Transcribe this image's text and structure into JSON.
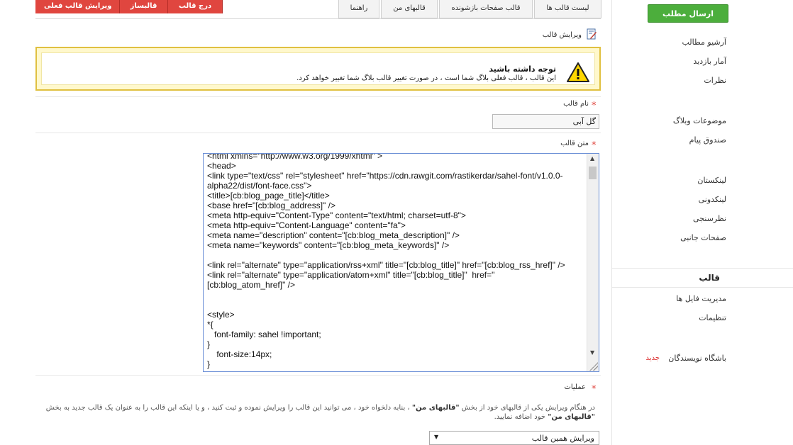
{
  "sidebar": {
    "send_button": "ارسال مطلب",
    "group1": [
      "آرشیو مطالب",
      "آمار بازدید",
      "نظرات"
    ],
    "group2": [
      "موضوعات وبلاگ",
      "صندوق پیام"
    ],
    "group3": [
      "لینکستان",
      "لینکدونی",
      "نظرسنجی",
      "صفحات جانبی"
    ],
    "section_title": "قالب",
    "group4": [
      "مدیریت فایل ها",
      "تنظیمات"
    ],
    "writers_club": "باشگاه نویسندگان",
    "new_badge": "جدید"
  },
  "top_buttons": [
    "ویرایش قالب فعلی",
    "قالبساز",
    "درج قالب"
  ],
  "tabs": [
    "لیست قالب ها",
    "قالب صفحات بازشونده",
    "قالبهای من",
    "راهنما"
  ],
  "page_heading": "ویرایش قالب",
  "warning": {
    "title": "توجه داشته باشید",
    "text": "این قالب ، قالب فعلی بلاگ شما است ، در صورت تغییر قالب بلاگ شما تغییر خواهد کرد."
  },
  "form": {
    "name_label": "نام قالب",
    "name_value": "گل آبی",
    "body_label": "متن قالب",
    "code_lines": [
      "<html xmlns=\"http://www.w3.org/1999/xhtml\" >",
      "<head>",
      "<link type=\"text/css\" rel=\"stylesheet\" href=\"https://cdn.rawgit.com/rastikerdar/sahel-font/v1.0.0-",
      "alpha22/dist/font-face.css\">",
      "<title>[cb:blog_page_title]</title>",
      "<base href=\"[cb:blog_address]\" />",
      "<meta http-equiv=\"Content-Type\" content=\"text/html; charset=utf-8\">",
      "<meta http-equiv=\"Content-Language\" content=\"fa\">",
      "<meta name=\"description\" content=\"[cb:blog_meta_description]\" />",
      "<meta name=\"keywords\" content=\"[cb:blog_meta_keywords]\" />",
      "",
      "<link rel=\"alternate\" type=\"application/rss+xml\" title=\"[cb:blog_title]\" href=\"[cb:blog_rss_href]\" />",
      "<link rel=\"alternate\" type=\"application/atom+xml\" title=\"[cb:blog_title]\"  href=\"",
      "[cb:blog_atom_href]\" />",
      "",
      "",
      "<style>",
      "*{",
      "   font-family: sahel !important;",
      "}",
      "    font-size:14px;",
      "}"
    ],
    "ops_label": "عملیات",
    "ops_desc_1": "در هنگام ویرایش یکی از قالبهای خود از بخش ",
    "ops_desc_bold_1": "\"قالبهای من\"",
    "ops_desc_2": " ، بنابه دلخواه خود ، می توانید این قالب را ویرایش نموده و ثبت کنید ، و یا اینکه این قالب را به عنوان یک قالب جدید به بخش ",
    "ops_desc_bold_2": "\"قالبهای من\"",
    "ops_desc_3": " خود اضافه نمایید.",
    "ops_select_value": "ویرایش همین قالب"
  },
  "colors": {
    "accent_green": "#4cae3c",
    "accent_red": "#e0463f",
    "warning_border": "#e0c040"
  }
}
